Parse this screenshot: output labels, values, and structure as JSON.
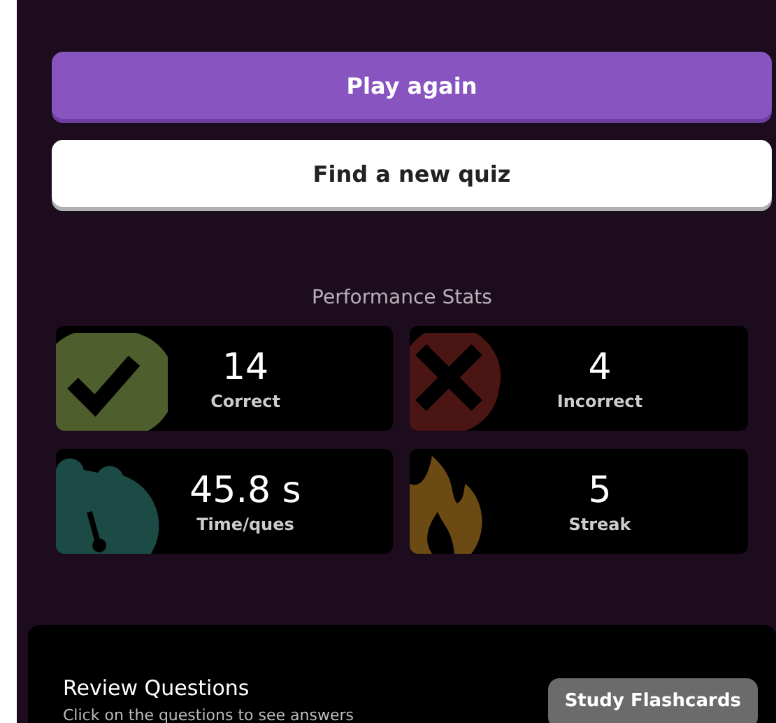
{
  "actions": [
    {
      "label": "Play again",
      "kind": "primary"
    },
    {
      "label": "Find a new quiz",
      "kind": "secondary"
    }
  ],
  "stats_title": "Performance Stats",
  "stats": [
    {
      "value": "14",
      "label": "Correct",
      "kind": "correct",
      "color": "#4e5e2c"
    },
    {
      "value": "4",
      "label": "Incorrect",
      "kind": "incorrect",
      "color": "#4a1512"
    },
    {
      "value": "45.8 s",
      "label": "Time/ques",
      "kind": "time",
      "color": "#1c4a45"
    },
    {
      "value": "5",
      "label": "Streak",
      "kind": "streak",
      "color": "#6b4a14"
    }
  ],
  "review": {
    "title": "Review Questions",
    "subtitle": "Click on the questions to see answers",
    "button": "Study Flashcards"
  }
}
